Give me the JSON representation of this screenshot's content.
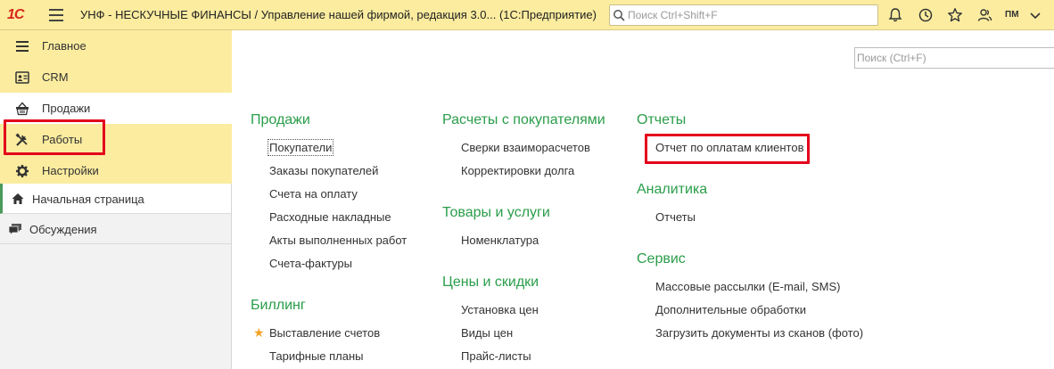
{
  "titlebar": {
    "logo": "1С",
    "title": "УНФ - НЕСКУЧНЫЕ ФИНАНСЫ / Управление нашей фирмой, редакция 3.0...  (1С:Предприятие)",
    "search_placeholder": "Поиск Ctrl+Shift+F",
    "user_initials": "ПМ",
    "icons": [
      "bell-icon",
      "history-icon",
      "star-icon",
      "users-icon",
      "chevron-down-icon"
    ]
  },
  "sections": {
    "items": [
      {
        "label": "Главное",
        "icon": "list-icon"
      },
      {
        "label": "CRM",
        "icon": "contact-card-icon"
      },
      {
        "label": "Продажи",
        "icon": "basket-icon",
        "active": true
      },
      {
        "label": "Работы",
        "icon": "tools-icon"
      },
      {
        "label": "Настройки",
        "icon": "gear-icon"
      }
    ]
  },
  "open_windows": {
    "items": [
      {
        "label": "Начальная страница",
        "icon": "home-icon",
        "active": true
      },
      {
        "label": "Обсуждения",
        "icon": "chat-icon"
      }
    ]
  },
  "main": {
    "search_placeholder": "Поиск (Ctrl+F)",
    "columns": [
      {
        "groups": [
          {
            "title": "Продажи",
            "commands": [
              "Покупатели",
              "Заказы покупателей",
              "Счета на оплату",
              "Расходные накладные",
              "Акты выполненных работ",
              "Счета-фактуры"
            ]
          },
          {
            "title": "Биллинг",
            "commands": [
              "Выставление счетов",
              "Тарифные планы"
            ]
          }
        ]
      },
      {
        "groups": [
          {
            "title": "Расчеты с покупателями",
            "commands": [
              "Сверки взаиморасчетов",
              "Корректировки долга"
            ]
          },
          {
            "title": "Товары и услуги",
            "commands": [
              "Номенклатура"
            ]
          },
          {
            "title": "Цены и скидки",
            "commands": [
              "Установка цен",
              "Виды цен",
              "Прайс-листы"
            ]
          }
        ]
      },
      {
        "groups": [
          {
            "title": "Отчеты",
            "commands": [
              "Отчет по оплатам клиентов"
            ]
          },
          {
            "title": "Аналитика",
            "commands": [
              "Отчеты"
            ]
          },
          {
            "title": "Сервис",
            "commands": [
              "Массовые рассылки (E-mail, SMS)",
              "Дополнительные обработки",
              "Загрузить документы из сканов (фото)"
            ]
          }
        ]
      }
    ]
  },
  "colors": {
    "panel_yellow": "#fbec9f",
    "group_green": "#2a9d4a",
    "highlight_red": "#e3001b",
    "favorite_star": "#f2a324"
  }
}
